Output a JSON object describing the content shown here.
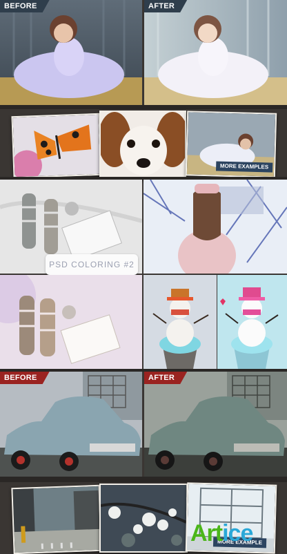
{
  "labels": {
    "before": "BEFORE",
    "after": "AFTER",
    "more_examples": "MORE EXAMPLES",
    "more_examples_partial": "MORE EXAMPLE",
    "psd_coloring": "PSD COLORING #2"
  },
  "watermark": {
    "part1": "Art",
    "part2": "ice"
  },
  "colors": {
    "ribbon_blue": "#2f3e4c",
    "ribbon_red": "#9a2320",
    "badge_blue": "#2c4460",
    "watermark_green": "#4bb61a",
    "watermark_blue": "#2aa8d8",
    "background": "#3a3633"
  }
}
